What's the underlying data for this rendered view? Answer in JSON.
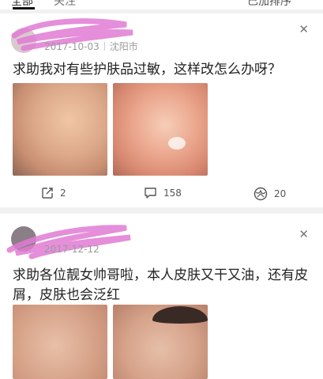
{
  "tabs": {
    "all_label": "全部",
    "second_label": "关注",
    "right_label": "已加排序"
  },
  "posts": [
    {
      "date": "2017-10-03",
      "city": "沈阳市",
      "title": "求助我对有些护肤品过敏，这样改怎么办呀？",
      "counts": {
        "share": "2",
        "comment": "158",
        "like": "20"
      }
    },
    {
      "date": "2017-12-12",
      "title": "求助各位靓女帅哥啦，本人皮肤又干又油，还有皮屑，皮肤也会泛红"
    }
  ],
  "icons": {
    "close": "close-icon",
    "share": "share-icon",
    "comment": "comment-icon",
    "like": "like-icon"
  },
  "colors": {
    "redaction_scribble": "#e07ad3",
    "meta_text": "#9b9b9b",
    "background": "#f1f1f1"
  }
}
